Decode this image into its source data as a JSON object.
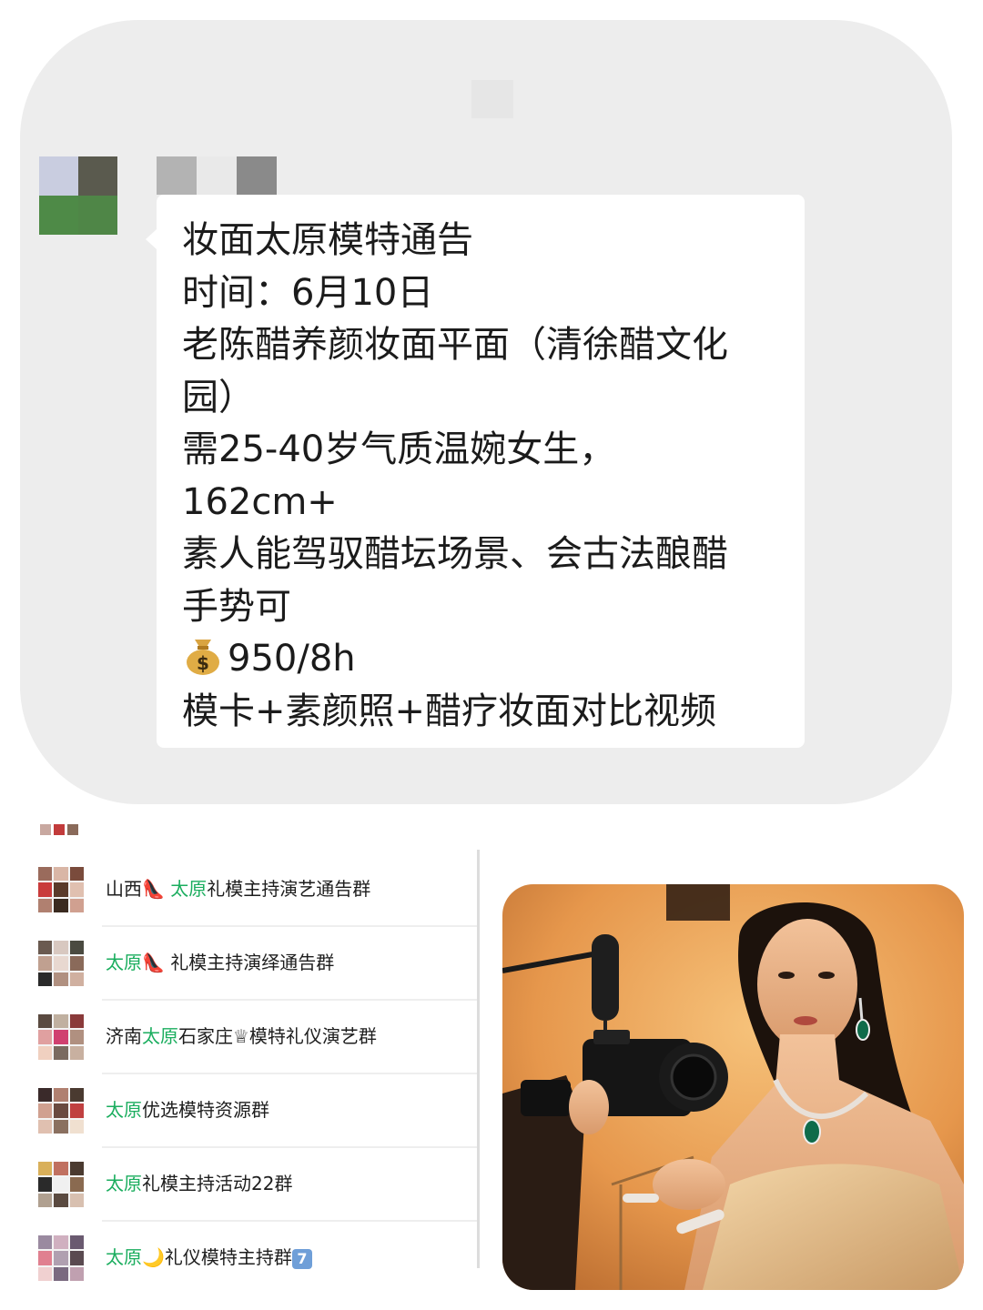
{
  "announcement": {
    "lines": [
      "妆面太原模特通告",
      "时间：6月10日",
      "老陈醋养颜妆面平面（清徐醋文化",
      "园）",
      "需25-40岁气质温婉女生，",
      "162cm+",
      "素人能驾驭醋坛场景、会古法酿醋",
      "手势可",
      "950/8h",
      "模卡+素颜照+醋疗妆面对比视频"
    ],
    "pay_icon": "money-bag-icon"
  },
  "groups": [
    {
      "prefix": "山西",
      "emoji": "👠",
      "highlight": "太原",
      "suffix": "礼模主持演艺通告群"
    },
    {
      "prefix": "",
      "highlight": "太原",
      "emoji": "👠",
      "suffix": " 礼模主持演绎通告群"
    },
    {
      "prefix": "济南",
      "highlight": "太原",
      "suffix": "石家庄♕模特礼仪演艺群"
    },
    {
      "prefix": "",
      "highlight": "太原",
      "suffix": "优选模特资源群"
    },
    {
      "prefix": "",
      "highlight": "太原",
      "suffix": "礼模主持活动22群"
    },
    {
      "prefix": "",
      "highlight": "太原",
      "emoji": "🌙",
      "suffix": "礼仪模特主持群",
      "badge": "7"
    }
  ],
  "colors": {
    "highlight": "#1aad5e",
    "card_bg": "#ededed",
    "bubble_bg": "#ffffff"
  }
}
